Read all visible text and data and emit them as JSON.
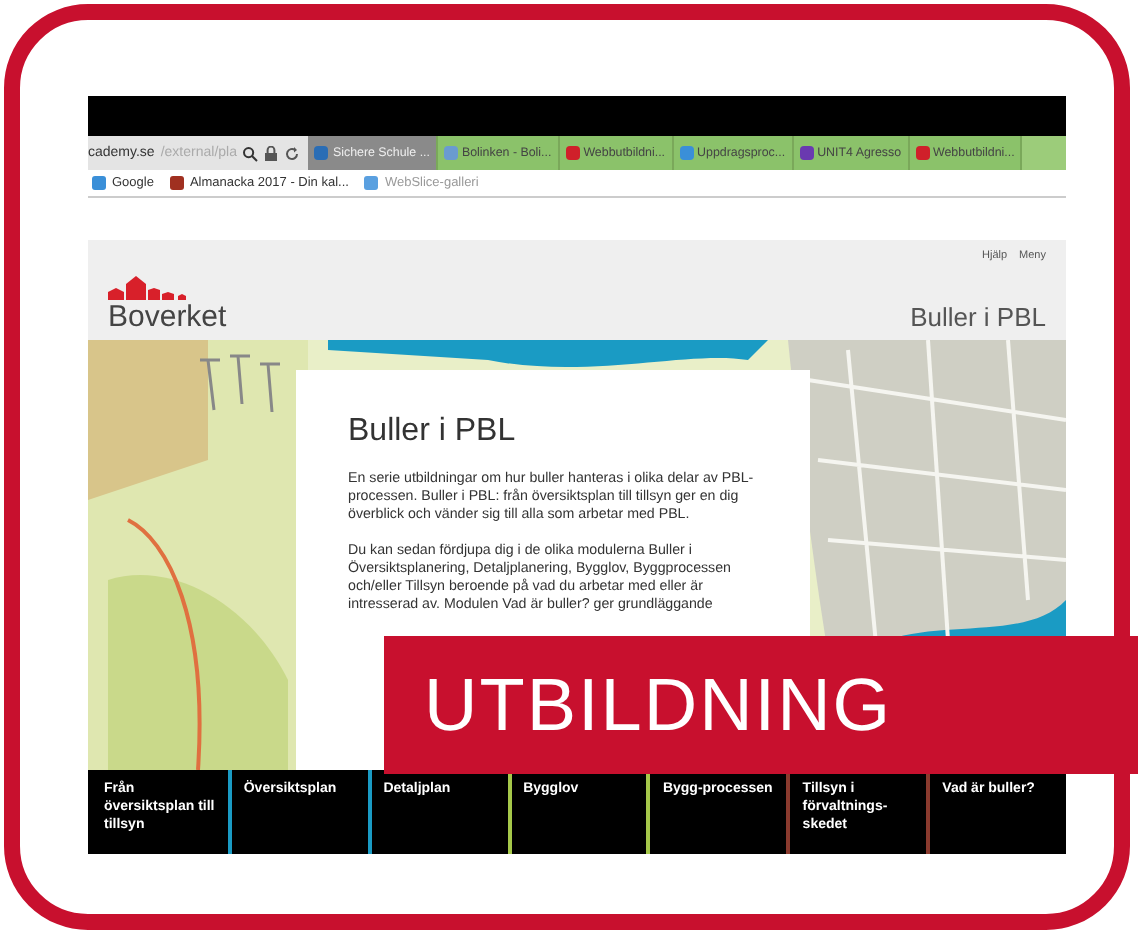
{
  "browser": {
    "address": {
      "host": "cademy.se",
      "path": "/external/pla"
    },
    "tabs": [
      {
        "label": "Sichere Schule ...",
        "selected": true
      },
      {
        "label": "Bolinken - Boli...",
        "selected": false
      },
      {
        "label": "Webbutbildni...",
        "selected": false
      },
      {
        "label": "Uppdragsproc...",
        "selected": false
      },
      {
        "label": "UNIT4 Agresso",
        "selected": false
      },
      {
        "label": "Webbutbildni...",
        "selected": false
      }
    ],
    "favorites": [
      "Google",
      "Almanacka 2017 - Din kal...",
      "WebSlice-galleri"
    ]
  },
  "page": {
    "logo": "Boverket",
    "top_links": [
      "Hjälp",
      "Meny"
    ],
    "section_title": "Buller i PBL",
    "card": {
      "title": "Buller i PBL",
      "paragraphs": [
        "En serie utbildningar om hur buller hanteras i olika delar av PBL-processen. Buller i PBL: från översiktsplan till tillsyn ger en dig överblick och vänder sig till alla som arbetar med PBL.",
        "Du kan sedan fördjupa dig i de olika modulerna Buller i Översiktsplanering, Detaljplanering, Bygglov, Byggprocessen och/eller Tillsyn beroende på vad du arbetar med eller är intresserad av. Modulen Vad är buller? ger grundläggande"
      ]
    },
    "nav": [
      {
        "label": "Från översiktsplan till tillsyn"
      },
      {
        "label": "Översiktsplan",
        "color": "#1a9bc4"
      },
      {
        "label": "Detaljplan",
        "color": "#1a9bc4"
      },
      {
        "label": "Bygglov",
        "color": "#a6c84a"
      },
      {
        "label": "Bygg-processen",
        "color": "#a6c84a"
      },
      {
        "label": "Tillsyn i förvaltnings-skedet",
        "color": "#8a3a2e"
      },
      {
        "label": "Vad är buller?",
        "color": "#8a3a2e"
      }
    ]
  },
  "banner": {
    "text": "UTBILDNING"
  }
}
